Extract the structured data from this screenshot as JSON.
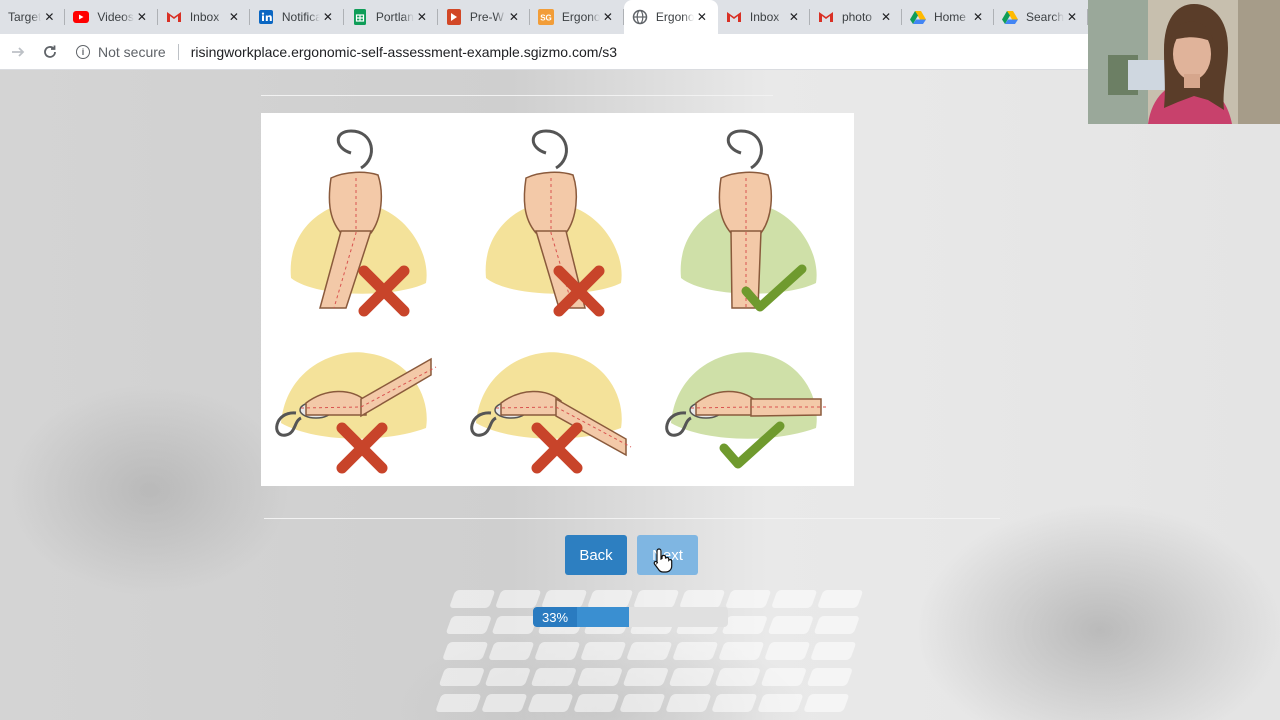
{
  "browser": {
    "tabs": [
      {
        "title": "Target",
        "icon": "target-favicon-icon",
        "active": false
      },
      {
        "title": "Videos",
        "icon": "youtube-icon",
        "active": false
      },
      {
        "title": "Inbox",
        "icon": "gmail-icon",
        "active": false
      },
      {
        "title": "Notifications",
        "icon": "linkedin-icon",
        "active": false
      },
      {
        "title": "Portland",
        "icon": "sheets-icon",
        "active": false
      },
      {
        "title": "Pre-W",
        "icon": "office-icon",
        "active": false
      },
      {
        "title": "Ergonomic",
        "icon": "sgizmo-icon",
        "active": false
      },
      {
        "title": "Ergonomic",
        "icon": "globe-icon",
        "active": true
      },
      {
        "title": "Inbox",
        "icon": "gmail-icon",
        "active": false
      },
      {
        "title": "photo",
        "icon": "gmail-icon",
        "active": false
      },
      {
        "title": "Home",
        "icon": "drive-icon",
        "active": false
      },
      {
        "title": "Search",
        "icon": "drive-icon",
        "active": false
      }
    ],
    "close_glyph": "✕",
    "security_label": "Not secure",
    "url": "risingworkplace.ergonomic-self-assessment-example.sgizmo.com/s3"
  },
  "survey": {
    "back_label": "Back",
    "next_label": "Next",
    "progress_label": "33%",
    "progress_value": 0.49
  },
  "colors": {
    "primary": "#2d7fc1",
    "primary_disabled": "#7fb6e2",
    "bad": "#c8442a",
    "good": "#6f9a2e"
  }
}
